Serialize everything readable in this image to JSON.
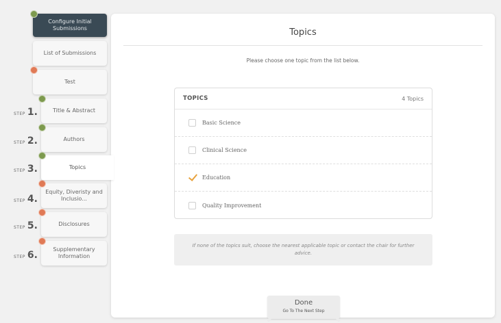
{
  "colors": {
    "done_dot": "#7d9a4e",
    "pending_dot": "#e07a56",
    "check": "#e8a23c",
    "nav_dark": "#3a4a55"
  },
  "nav": {
    "configure": {
      "label": "Configure Initial Submissions",
      "dot": "green"
    },
    "list": {
      "label": "List of Submissions"
    },
    "test": {
      "label": "Test",
      "dot": "orange"
    }
  },
  "steps": [
    {
      "prefix": "STEP",
      "number": "1.",
      "label": "Title & Abstract",
      "dot": "green"
    },
    {
      "prefix": "STEP",
      "number": "2.",
      "label": "Authors",
      "dot": "green"
    },
    {
      "prefix": "STEP",
      "number": "3.",
      "label": "Topics",
      "dot": "green"
    },
    {
      "prefix": "STEP",
      "number": "4.",
      "label": "Equity, Diveristy and Inclusio...",
      "dot": "orange"
    },
    {
      "prefix": "STEP",
      "number": "5.",
      "label": "Disclosures",
      "dot": "orange"
    },
    {
      "prefix": "STEP",
      "number": "6.",
      "label": "Supplementary Information",
      "dot": "orange"
    }
  ],
  "main": {
    "title": "Topics",
    "instruction": "Please choose one topic from the list below.",
    "topics_header": "TOPICS",
    "topics_count": "4 Topics",
    "topics": [
      {
        "label": "Basic Science",
        "checked": false
      },
      {
        "label": "Clinical Science",
        "checked": false
      },
      {
        "label": "Education",
        "checked": true
      },
      {
        "label": "Quality Improvement",
        "checked": false
      }
    ],
    "note": "If none of the topics suit, choose the nearest applicable topic or contact the chair for further advice.",
    "done_label": "Done",
    "done_sub": "Go To The Next Step"
  }
}
